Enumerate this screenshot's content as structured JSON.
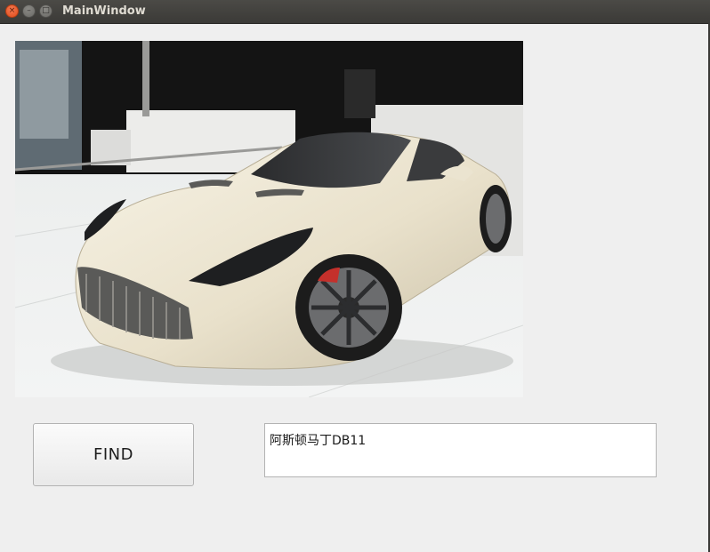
{
  "window": {
    "title": "MainWindow",
    "controls": {
      "close": "×",
      "minimize": "–",
      "maximize": "□"
    }
  },
  "image": {
    "description_icon": "car-photo",
    "alt": "white sports car"
  },
  "find_button": {
    "label": "FIND"
  },
  "result": {
    "text": "阿斯顿马丁DB11"
  },
  "colors": {
    "titlebar": "#3f3e3a",
    "close": "#df4b1a",
    "window_bg": "#efefef"
  }
}
